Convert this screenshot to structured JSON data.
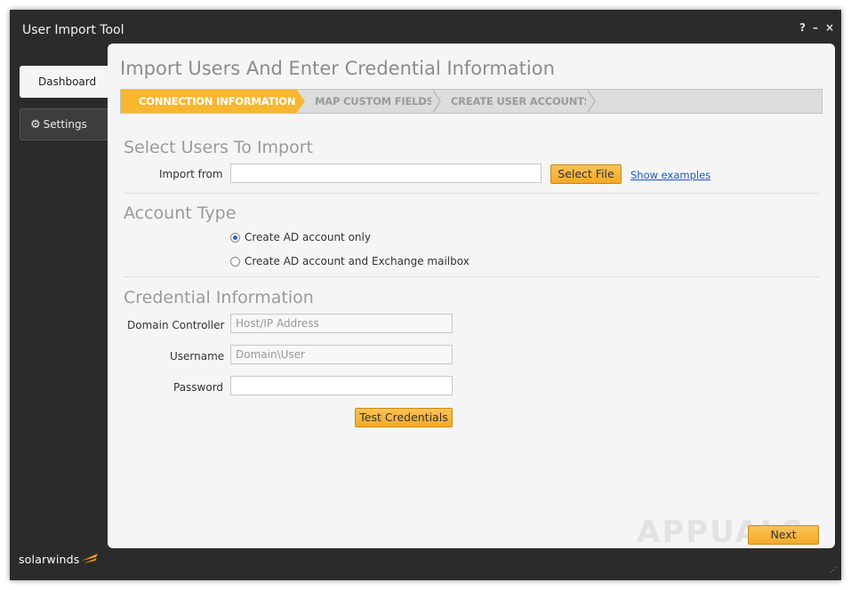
{
  "window": {
    "title": "User Import Tool",
    "controls": {
      "help": "?",
      "minimize": "–",
      "close": "×"
    }
  },
  "nav": {
    "dashboard": "Dashboard",
    "settings": "Settings"
  },
  "page": {
    "title": "Import Users And Enter Credential Information",
    "steps": [
      {
        "label": "CONNECTION INFORMATION",
        "active": true
      },
      {
        "label": "MAP CUSTOM FIELDS",
        "active": false
      },
      {
        "label": "CREATE USER ACCOUNTS",
        "active": false
      }
    ]
  },
  "select_users": {
    "title": "Select Users To Import",
    "import_from_label": "Import from",
    "import_from_value": "",
    "select_file": "Select File",
    "show_examples": "Show examples"
  },
  "account_type": {
    "title": "Account Type",
    "options": [
      {
        "label": "Create AD account only",
        "checked": true
      },
      {
        "label": "Create AD account and Exchange mailbox",
        "checked": false
      }
    ]
  },
  "credentials": {
    "title": "Credential Information",
    "domain_controller_label": "Domain Controller",
    "domain_controller_placeholder": "Host/IP Address",
    "username_label": "Username",
    "username_placeholder": "Domain\\User",
    "password_label": "Password",
    "password_value": "",
    "test_button": "Test Credentials"
  },
  "footer": {
    "next": "Next",
    "brand": "solarwinds",
    "watermark": "APPUALS"
  },
  "colors": {
    "accent": "#f7b72f",
    "window_bg": "#2b2b2b",
    "panel_bg": "#f5f5f5",
    "link": "#1a56c8"
  }
}
